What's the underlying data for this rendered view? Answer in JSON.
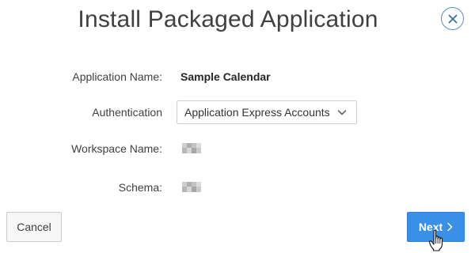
{
  "dialog": {
    "title": "Install Packaged Application"
  },
  "form": {
    "application_name_label": "Application Name:",
    "application_name_value": "Sample Calendar",
    "authentication_label": "Authentication",
    "authentication_value": "Application Express Accounts",
    "workspace_name_label": "Workspace Name:",
    "schema_label": "Schema:"
  },
  "buttons": {
    "cancel_label": "Cancel",
    "next_label": "Next"
  },
  "icons": {
    "close": "close-icon",
    "select_chevron": "chevron-down-icon",
    "next_chevron": "chevron-right-icon",
    "cursor": "hand-pointer-cursor-icon"
  },
  "colors": {
    "primary_button": "#3a8fe6",
    "close_border": "#5a8fc6",
    "title_text": "#404040"
  }
}
